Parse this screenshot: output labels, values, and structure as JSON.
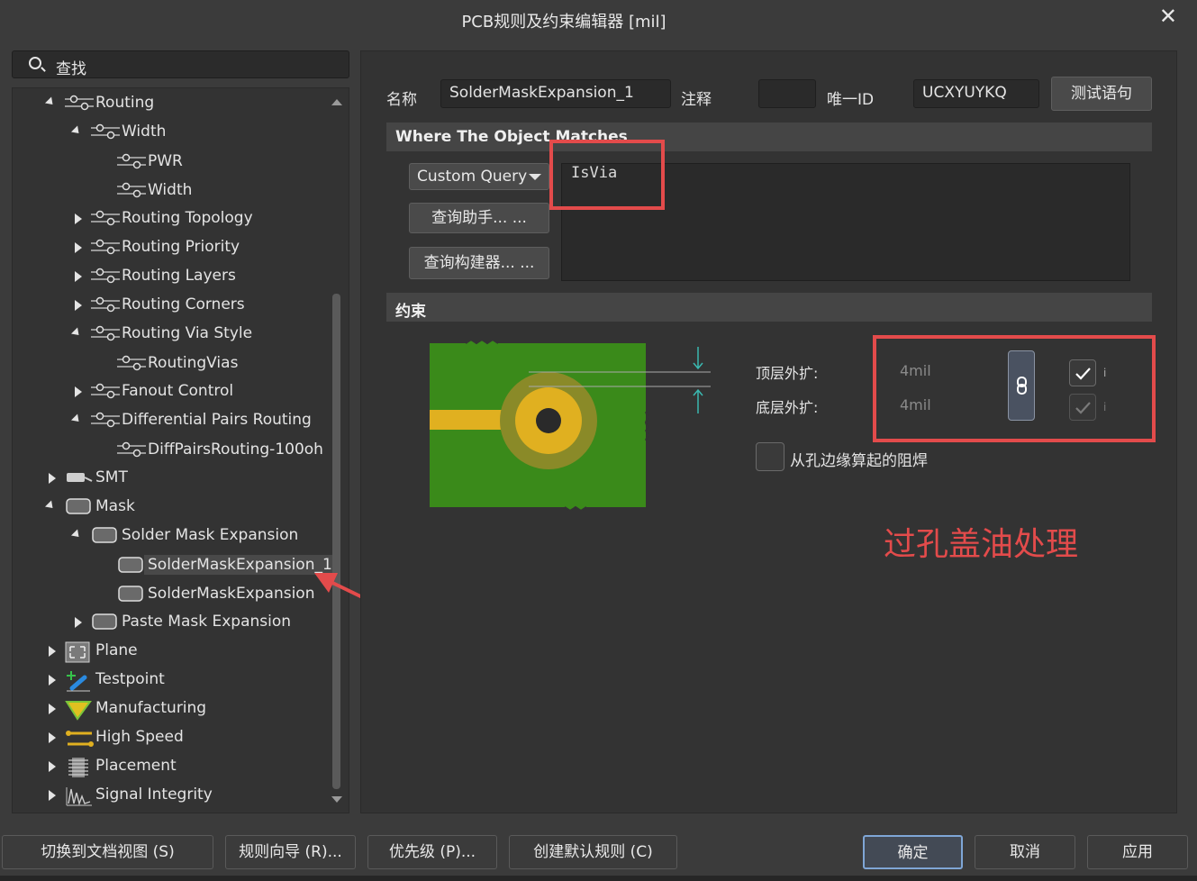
{
  "window": {
    "title": "PCB规则及约束编辑器 [mil]",
    "close_glyph": "✕"
  },
  "search": {
    "placeholder": "查找"
  },
  "tree": {
    "items": [
      {
        "label": "Routing"
      },
      {
        "label": "Width"
      },
      {
        "label": "PWR"
      },
      {
        "label": "Width"
      },
      {
        "label": "Routing Topology"
      },
      {
        "label": "Routing Priority"
      },
      {
        "label": "Routing Layers"
      },
      {
        "label": "Routing Corners"
      },
      {
        "label": "Routing Via Style"
      },
      {
        "label": "RoutingVias"
      },
      {
        "label": "Fanout Control"
      },
      {
        "label": "Differential Pairs Routing"
      },
      {
        "label": "DiffPairsRouting-100oh"
      },
      {
        "label": "SMT"
      },
      {
        "label": "Mask"
      },
      {
        "label": "Solder Mask Expansion"
      },
      {
        "label": "SolderMaskExpansion_1"
      },
      {
        "label": "SolderMaskExpansion"
      },
      {
        "label": "Paste Mask Expansion"
      },
      {
        "label": "Plane"
      },
      {
        "label": "Testpoint"
      },
      {
        "label": "Manufacturing"
      },
      {
        "label": "High Speed"
      },
      {
        "label": "Placement"
      },
      {
        "label": "Signal Integrity"
      }
    ]
  },
  "rule": {
    "name_label": "名称",
    "name_value": "SolderMaskExpansion_1",
    "comment_label": "注释",
    "comment_value": "",
    "uid_label": "唯一ID",
    "uid_value": "UCXYUYKQ",
    "test_button": "测试语句"
  },
  "where": {
    "section_title": "Where The Object Matches",
    "query_type": "Custom Query",
    "helper_button": "查询助手... ...",
    "builder_button": "查询构建器... ...",
    "query_text": "IsVia"
  },
  "constraints": {
    "section_title": "约束",
    "top_label": "顶层外扩:",
    "top_value": "4mil",
    "bottom_label": "底层外扩:",
    "bottom_value": "4mil",
    "from_hole_label": "从孔边缘算起的阻焊",
    "top_checked": true,
    "bottom_checked": true,
    "annotation": "过孔盖油处理"
  },
  "footer": {
    "switch_view": "切换到文档视图 (S)",
    "rule_wizard": "规则向导 (R)...",
    "priority": "优先级 (P)...",
    "create_default": "创建默认规则 (C)",
    "ok": "确定",
    "cancel": "取消",
    "apply": "应用"
  },
  "colors": {
    "annotation_red": "#e34b4b",
    "pcb_green": "#3a8a1a",
    "pad_yellow": "#e0b020",
    "mask_ring": "#8a8a28"
  }
}
